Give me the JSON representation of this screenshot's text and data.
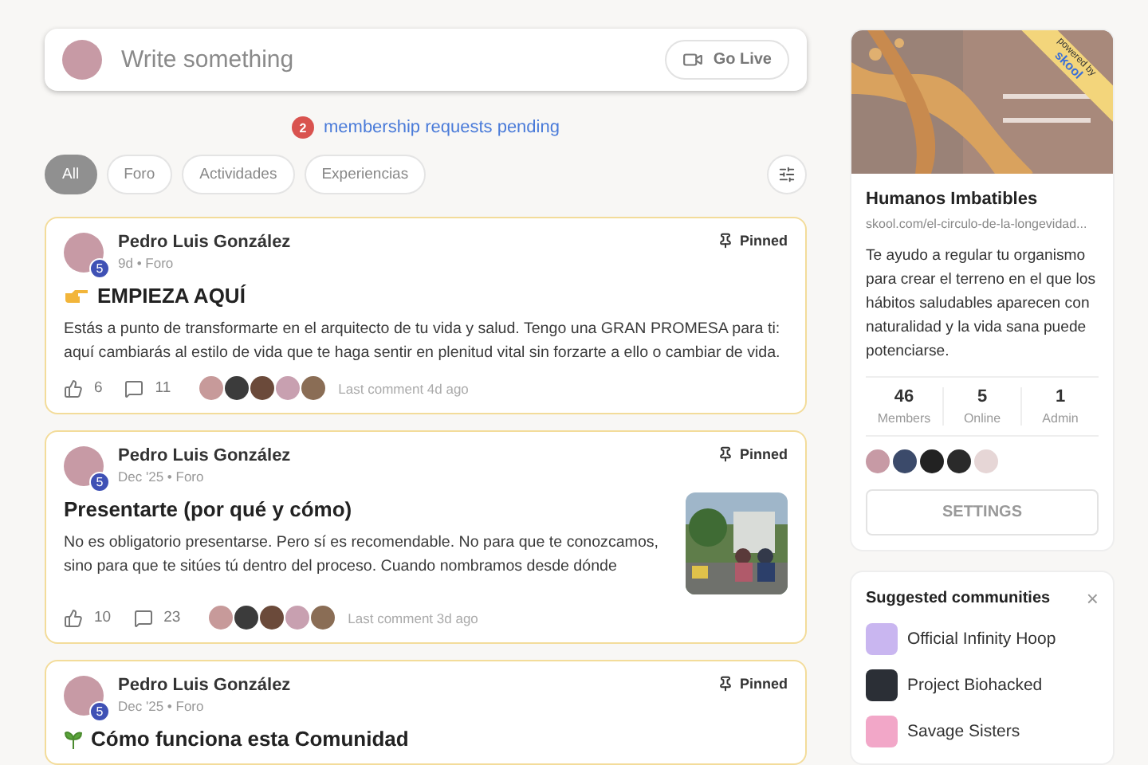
{
  "composer": {
    "placeholder": "Write something",
    "button": "Go Live"
  },
  "pending": {
    "count": "2",
    "text": "membership requests pending"
  },
  "filters": [
    {
      "label": "All",
      "selected": true
    },
    {
      "label": "Foro",
      "selected": false
    },
    {
      "label": "Actividades",
      "selected": false
    },
    {
      "label": "Experiencias",
      "selected": false
    }
  ],
  "posts": [
    {
      "kind": "hand",
      "author": "Pedro Luis González",
      "level": "5",
      "meta": "9d • Foro",
      "pinned": "Pinned",
      "title": "EMPIEZA AQUÍ",
      "body": "Estás a punto de transformarte en el arquitecto de tu vida y salud. Tengo una GRAN PROMESA para ti: aquí cambiarás al estilo de vida que te haga sentir en plenitud vital sin forzarte a ello o cambiar de vida.",
      "likes": "6",
      "comments": "11",
      "last_comment": "Last comment 4d ago"
    },
    {
      "kind": "plain",
      "author": "Pedro Luis González",
      "level": "5",
      "meta": "Dec '25 • Foro",
      "pinned": "Pinned",
      "title": "Presentarte (por qué y cómo)",
      "body": "No es obligatorio presentarse. Pero sí es recomendable. No para que te conozcamos, sino para que te sitúes tú dentro del proceso. Cuando nombramos desde dónde",
      "likes": "10",
      "comments": "23",
      "last_comment": "Last comment 3d ago",
      "image": true
    },
    {
      "kind": "sprout",
      "author": "Pedro Luis González",
      "level": "5",
      "meta": "Dec '25 • Foro",
      "pinned": "Pinned",
      "title": "Cómo funciona esta Comunidad"
    }
  ],
  "community": {
    "ribbon": {
      "text": "powered by",
      "brand": "skool"
    },
    "name": "Humanos Imbatibles",
    "url": "skool.com/el-circulo-de-la-longevidad...",
    "description": "Te ayudo a regular tu organismo para crear el terreno en el que los hábitos saludables aparecen con naturalidad y la vida sana puede potenciarse.",
    "stats": [
      {
        "value": "46",
        "label": "Members"
      },
      {
        "value": "5",
        "label": "Online"
      },
      {
        "value": "1",
        "label": "Admin"
      }
    ],
    "button": "SETTINGS"
  },
  "suggested": {
    "title": "Suggested communities",
    "close": "×",
    "items": [
      {
        "name": "Official Infinity Hoop",
        "color": "#c9b6f0"
      },
      {
        "name": "Project Biohacked",
        "color": "#2b2f36"
      },
      {
        "name": "Savage Sisters",
        "color": "#f2a7c8"
      }
    ]
  }
}
